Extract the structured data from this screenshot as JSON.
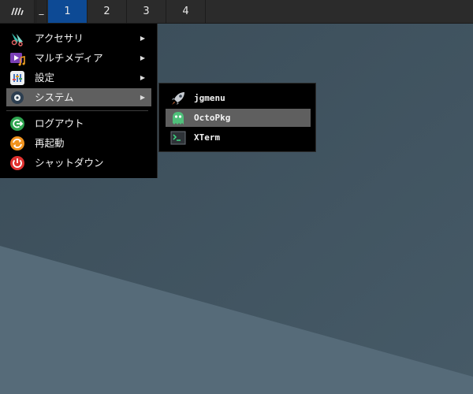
{
  "colors": {
    "panel": "#2b2b2b",
    "active_workspace": "#0d4a95",
    "menu_bg": "#000000",
    "selection": "#5f5f5f",
    "wallpaper_top": "#3f5360",
    "wallpaper_bottom": "#566a78"
  },
  "panel": {
    "launcher_icon": "menu-launcher-icon",
    "show_desktop_label": "_",
    "workspaces": [
      {
        "label": "1",
        "active": true
      },
      {
        "label": "2",
        "active": false
      },
      {
        "label": "3",
        "active": false
      },
      {
        "label": "4",
        "active": false
      }
    ]
  },
  "main_menu": {
    "items": [
      {
        "label": "アクセサリ",
        "icon": "accessories-icon",
        "submenu": true
      },
      {
        "label": "マルチメディア",
        "icon": "multimedia-icon",
        "submenu": true
      },
      {
        "label": "設定",
        "icon": "settings-icon",
        "submenu": true
      },
      {
        "label": "システム",
        "icon": "system-icon",
        "submenu": true,
        "selected": true
      },
      {
        "label": "ログアウト",
        "icon": "logout-icon",
        "submenu": false
      },
      {
        "label": "再起動",
        "icon": "restart-icon",
        "submenu": false
      },
      {
        "label": "シャットダウン",
        "icon": "shutdown-icon",
        "submenu": false
      }
    ],
    "arrow": "▶"
  },
  "system_submenu": {
    "items": [
      {
        "label": "jgmenu",
        "icon": "rocket-icon"
      },
      {
        "label": "OctoPkg",
        "icon": "octopkg-icon",
        "selected": true
      },
      {
        "label": "XTerm",
        "icon": "terminal-icon"
      }
    ]
  }
}
